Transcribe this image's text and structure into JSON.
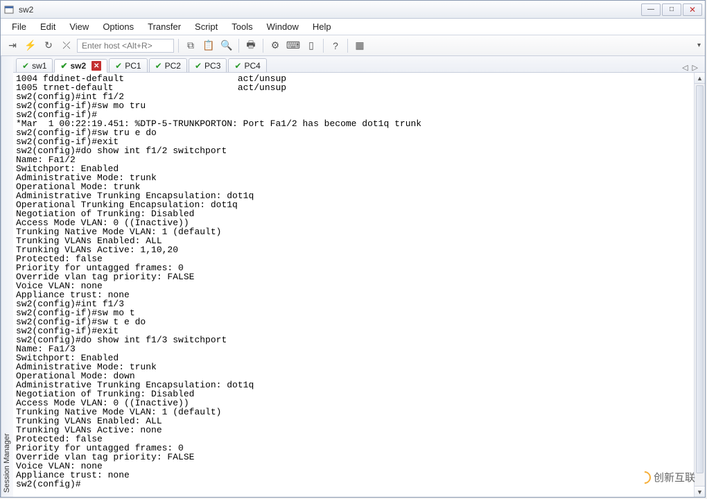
{
  "window": {
    "title": "sw2"
  },
  "menu": {
    "items": [
      "File",
      "Edit",
      "View",
      "Options",
      "Transfer",
      "Script",
      "Tools",
      "Window",
      "Help"
    ]
  },
  "toolbar": {
    "host_placeholder": "Enter host <Alt+R>"
  },
  "sidebar": {
    "label": "Session Manager"
  },
  "tabs": {
    "items": [
      {
        "label": "sw1",
        "active": false
      },
      {
        "label": "sw2",
        "active": true,
        "closeable": true
      },
      {
        "label": "PC1",
        "active": false
      },
      {
        "label": "PC2",
        "active": false
      },
      {
        "label": "PC3",
        "active": false
      },
      {
        "label": "PC4",
        "active": false
      }
    ]
  },
  "terminal": {
    "lines": [
      "1004 fddinet-default                     act/unsup",
      "1005 trnet-default                       act/unsup",
      "sw2(config)#int f1/2",
      "sw2(config-if)#sw mo tru",
      "sw2(config-if)#",
      "*Mar  1 00:22:19.451: %DTP-5-TRUNKPORTON: Port Fa1/2 has become dot1q trunk",
      "sw2(config-if)#sw tru e do",
      "sw2(config-if)#exit",
      "sw2(config)#do show int f1/2 switchport",
      "Name: Fa1/2",
      "Switchport: Enabled",
      "Administrative Mode: trunk",
      "Operational Mode: trunk",
      "Administrative Trunking Encapsulation: dot1q",
      "Operational Trunking Encapsulation: dot1q",
      "Negotiation of Trunking: Disabled",
      "Access Mode VLAN: 0 ((Inactive))",
      "Trunking Native Mode VLAN: 1 (default)",
      "Trunking VLANs Enabled: ALL",
      "Trunking VLANs Active: 1,10,20",
      "Protected: false",
      "Priority for untagged frames: 0",
      "Override vlan tag priority: FALSE",
      "Voice VLAN: none",
      "Appliance trust: none",
      "sw2(config)#int f1/3",
      "sw2(config-if)#sw mo t",
      "sw2(config-if)#sw t e do",
      "sw2(config-if)#exit",
      "sw2(config)#do show int f1/3 switchport",
      "Name: Fa1/3",
      "Switchport: Enabled",
      "Administrative Mode: trunk",
      "Operational Mode: down",
      "Administrative Trunking Encapsulation: dot1q",
      "Negotiation of Trunking: Disabled",
      "Access Mode VLAN: 0 ((Inactive))",
      "Trunking Native Mode VLAN: 1 (default)",
      "Trunking VLANs Enabled: ALL",
      "Trunking VLANs Active: none",
      "Protected: false",
      "Priority for untagged frames: 0",
      "Override vlan tag priority: FALSE",
      "Voice VLAN: none",
      "Appliance trust: none",
      "sw2(config)#"
    ]
  },
  "watermark": {
    "text": "创新互联"
  }
}
